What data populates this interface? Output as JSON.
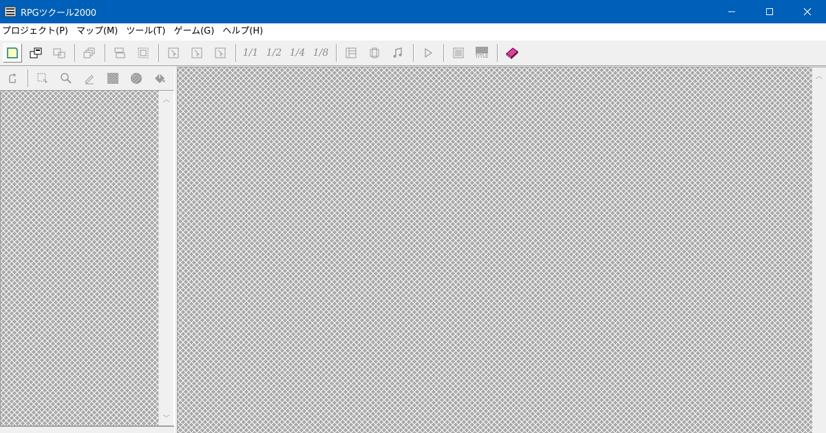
{
  "window": {
    "title": "RPGツクール2000",
    "minimize_icon": "minimize-icon",
    "maximize_icon": "maximize-icon",
    "close_icon": "close-icon"
  },
  "menu": [
    {
      "label": "プロジェクト(P)"
    },
    {
      "label": "マップ(M)"
    },
    {
      "label": "ツール(T)"
    },
    {
      "label": "ゲーム(G)"
    },
    {
      "label": "ヘルプ(H)"
    }
  ],
  "toolbar": {
    "zoom_1_1": "1/1",
    "zoom_1_2": "1/2",
    "zoom_1_4": "1/4",
    "zoom_1_8": "1/8",
    "title_label": "TITLE"
  },
  "colors": {
    "titlebar": "#005fb8",
    "accent_help": "#c0308a",
    "pattern_light": "#ffffff",
    "pattern_dark": "#a8a8a8"
  }
}
